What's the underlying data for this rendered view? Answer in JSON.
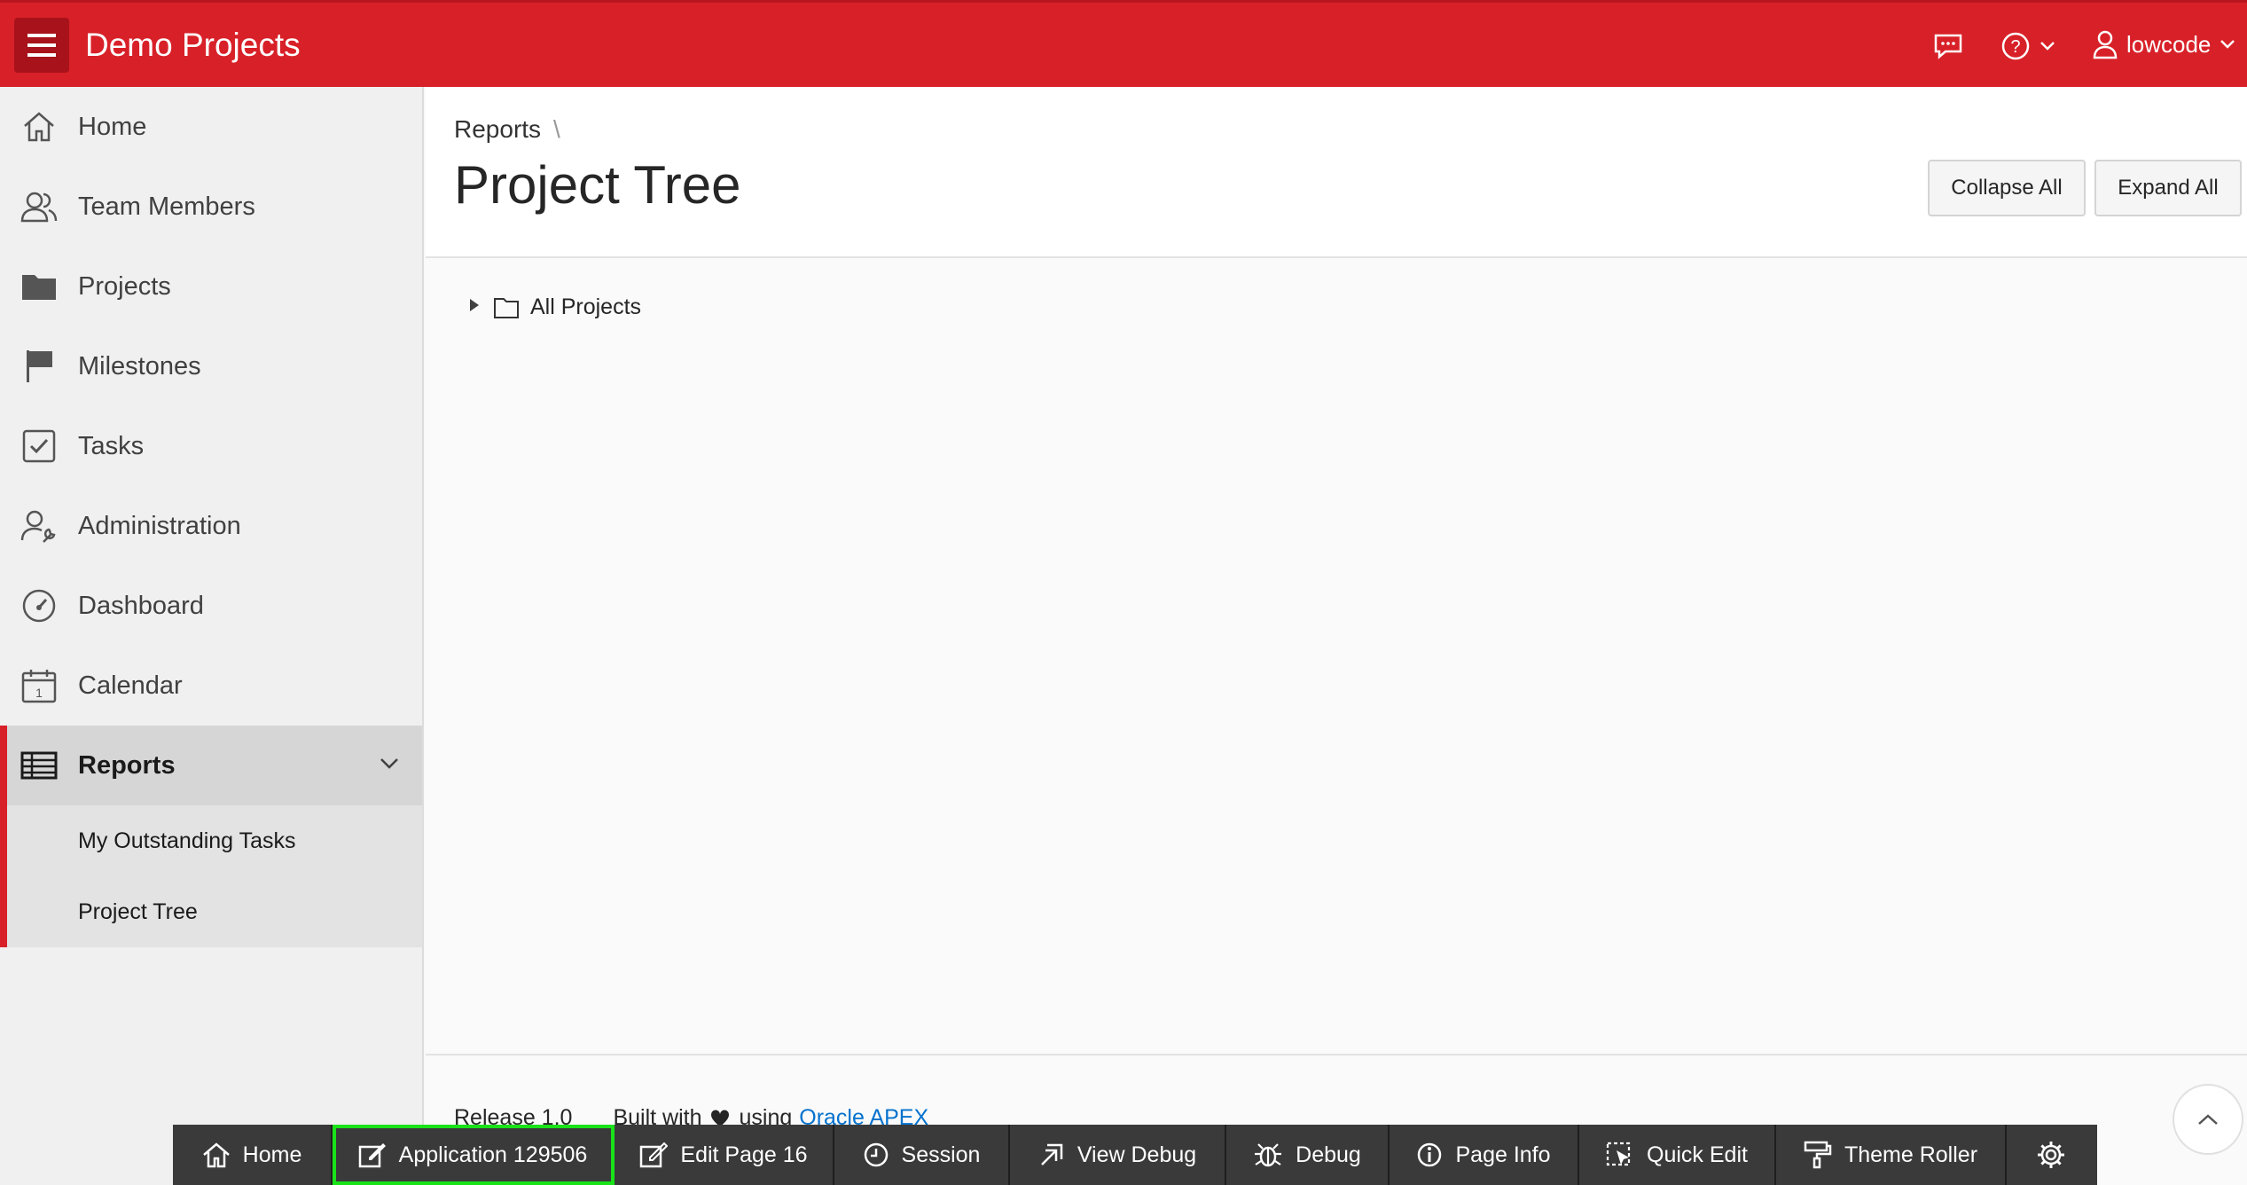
{
  "header": {
    "app_title": "Demo Projects",
    "user_name": "lowcode",
    "icons": [
      "menu-icon",
      "chat-icon",
      "help-icon",
      "user-icon"
    ]
  },
  "sidebar": {
    "items": [
      {
        "label": "Home",
        "icon": "home-icon"
      },
      {
        "label": "Team Members",
        "icon": "users-icon"
      },
      {
        "label": "Projects",
        "icon": "folder-icon"
      },
      {
        "label": "Milestones",
        "icon": "flag-icon"
      },
      {
        "label": "Tasks",
        "icon": "checkbox-icon"
      },
      {
        "label": "Administration",
        "icon": "user-wrench-icon"
      },
      {
        "label": "Dashboard",
        "icon": "gauge-icon"
      },
      {
        "label": "Calendar",
        "icon": "calendar-icon"
      },
      {
        "label": "Reports",
        "icon": "table-icon"
      }
    ],
    "sub_items": [
      "My Outstanding Tasks",
      "Project Tree"
    ]
  },
  "main": {
    "breadcrumb": "Reports",
    "breadcrumb_sep": "\\",
    "page_title": "Project Tree",
    "collapse_label": "Collapse All",
    "expand_label": "Expand All",
    "tree_root": "All Projects"
  },
  "footer": {
    "release": "Release 1.0",
    "built_with": "Built with",
    "using": "using",
    "link": "Oracle APEX"
  },
  "devbar": {
    "items": [
      {
        "label": "Home",
        "icon": "home-icon"
      },
      {
        "label": "Application 129506",
        "icon": "edit-icon"
      },
      {
        "label": "Edit Page 16",
        "icon": "edit-icon"
      },
      {
        "label": "Session",
        "icon": "clock-icon"
      },
      {
        "label": "View Debug",
        "icon": "view-debug-icon"
      },
      {
        "label": "Debug",
        "icon": "bug-icon"
      },
      {
        "label": "Page Info",
        "icon": "info-icon"
      },
      {
        "label": "Quick Edit",
        "icon": "cursor-select-icon"
      },
      {
        "label": "Theme Roller",
        "icon": "paint-roller-icon"
      }
    ]
  },
  "colors": {
    "brand": "#d82028",
    "highlight": "#19e219",
    "link": "#0572ce"
  }
}
